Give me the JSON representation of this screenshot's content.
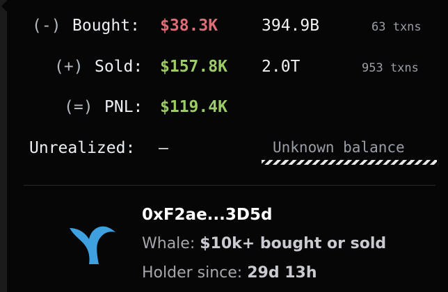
{
  "trades": {
    "bought": {
      "symbol": "(-)",
      "label": "Bought:",
      "value": "$38.3K",
      "quantity": "394.9B",
      "txns": "63 txns"
    },
    "sold": {
      "symbol": "(+)",
      "label": "Sold:",
      "value": "$157.8K",
      "quantity": "2.0T",
      "txns": "953 txns"
    },
    "pnl": {
      "symbol": "(=)",
      "label": "PNL:",
      "value": "$119.4K"
    },
    "unrealized": {
      "label": "Unrealized:",
      "value": "–",
      "note": "Unknown balance"
    }
  },
  "colors": {
    "negative": "#e06c75",
    "positive": "#9ccc65",
    "whale": "#3fa0e0"
  },
  "profile": {
    "address": "0xF2ae...3D5d",
    "icon": "whale-tail-icon",
    "whale_prefix": "Whale: ",
    "whale_text": "$10k+ bought or sold",
    "holder_prefix": "Holder since: ",
    "holder_value": "29d 13h"
  }
}
